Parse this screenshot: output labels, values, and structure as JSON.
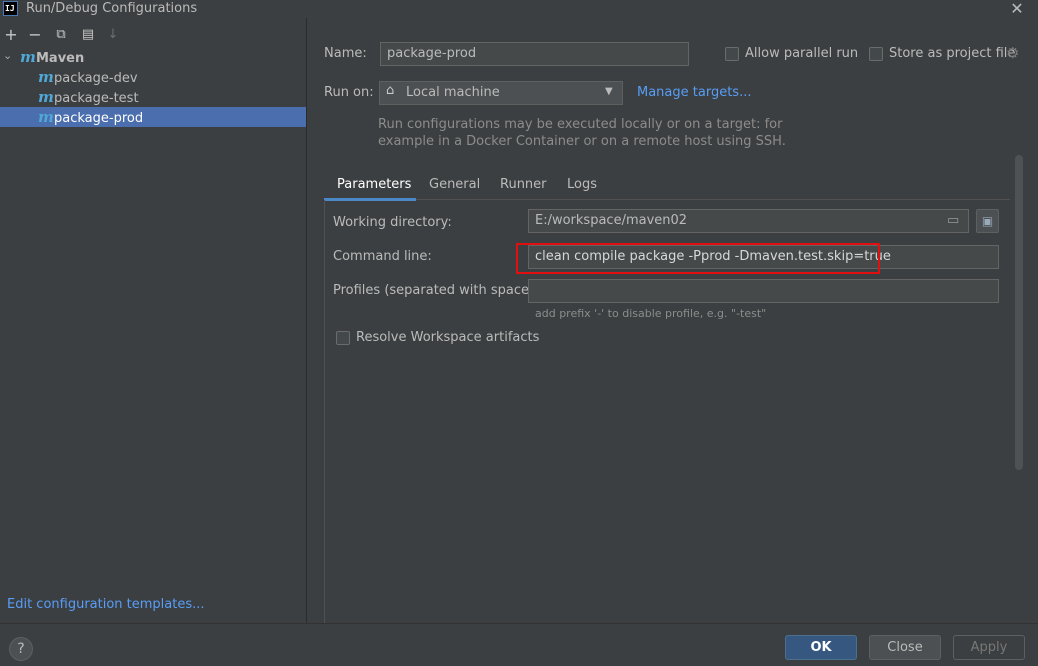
{
  "window": {
    "title": "Run/Debug Configurations",
    "logo_text": "IJ",
    "close_glyph": "✕"
  },
  "toolbar": {
    "add": "+",
    "remove": "−",
    "copy": "⧉",
    "new_folder": "▤",
    "sort": "↓"
  },
  "tree": {
    "root": {
      "label": "Maven",
      "icon": "m"
    },
    "items": [
      {
        "label": "package-dev",
        "icon": "m",
        "selected": false
      },
      {
        "label": "package-test",
        "icon": "m",
        "selected": false
      },
      {
        "label": "package-prod",
        "icon": "m",
        "selected": true
      }
    ]
  },
  "edit_templates_link": "Edit configuration templates...",
  "config": {
    "name_label": "Name:",
    "name_value": "package-prod",
    "allow_parallel_label": "Allow parallel run",
    "allow_parallel_checked": false,
    "store_as_project_label": "Store as project file",
    "store_as_project_checked": false,
    "run_on_label": "Run on:",
    "run_on_value": "Local machine",
    "manage_targets": "Manage targets...",
    "run_on_hint_line1": "Run configurations may be executed locally or on a target: for",
    "run_on_hint_line2": "example in a Docker Container or on a remote host using SSH."
  },
  "tabs": [
    {
      "label": "Parameters",
      "active": true
    },
    {
      "label": "General",
      "active": false
    },
    {
      "label": "Runner",
      "active": false
    },
    {
      "label": "Logs",
      "active": false
    }
  ],
  "parameters": {
    "working_dir_label": "Working directory:",
    "working_dir_value": "E:/workspace/maven02",
    "command_line_label": "Command line:",
    "command_line_value": "clean compile package -Pprod -Dmaven.test.skip=true",
    "profiles_label": "Profiles (separated with space):",
    "profiles_value": "",
    "profiles_hint": "add prefix '-' to disable profile, e.g. \"-test\"",
    "resolve_workspace_label": "Resolve Workspace artifacts",
    "resolve_workspace_checked": false
  },
  "buttons": {
    "help": "?",
    "ok": "OK",
    "close": "Close",
    "apply": "Apply"
  },
  "colors": {
    "background": "#3c3f41",
    "selection": "#4b6eaf",
    "link": "#589df6",
    "highlight_box": "#e01010",
    "maven_icon": "#4fa8d8"
  }
}
